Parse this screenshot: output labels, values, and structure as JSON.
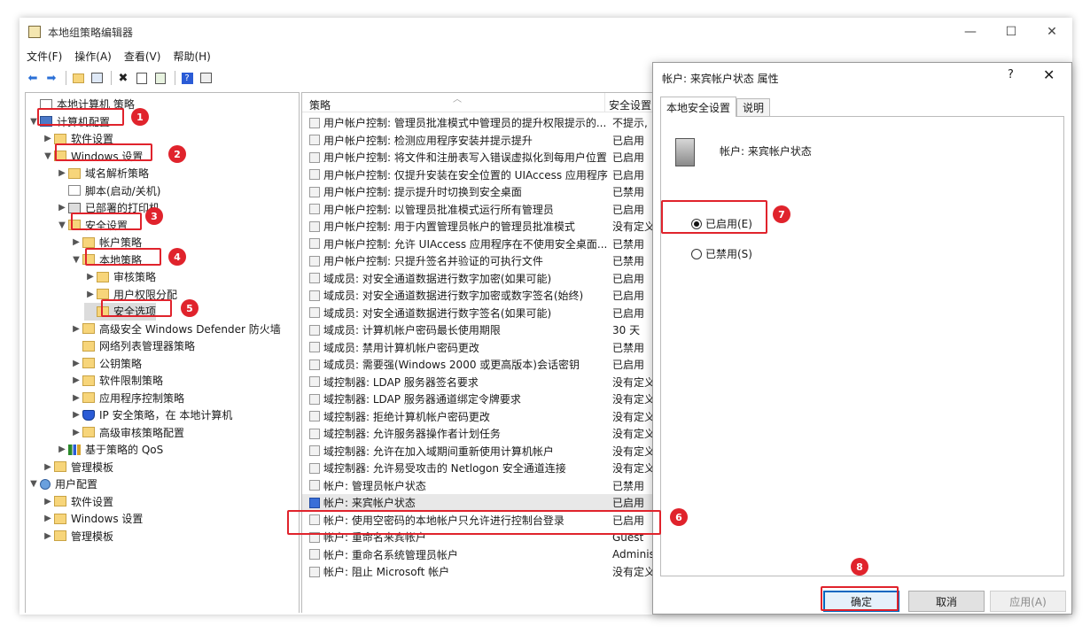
{
  "window": {
    "title": "本地组策略编辑器",
    "controls": [
      "—",
      "☐",
      "✕"
    ]
  },
  "menu": [
    "文件(F)",
    "操作(A)",
    "查看(V)",
    "帮助(H)"
  ],
  "toolbar_icons": [
    "back-arrow-icon",
    "forward-arrow-icon",
    "up-folder-icon",
    "show-tree-icon",
    "delete-icon",
    "properties-icon",
    "export-icon",
    "help-icon",
    "view-icon"
  ],
  "tree": [
    {
      "label": "本地计算机 策略",
      "icon": "policy",
      "depth": 0,
      "arrow": ""
    },
    {
      "label": "计算机配置",
      "icon": "pc",
      "depth": 0,
      "arrow": "▼"
    },
    {
      "label": "软件设置",
      "icon": "folder",
      "depth": 1,
      "arrow": "▶"
    },
    {
      "label": "Windows 设置",
      "icon": "folder",
      "depth": 1,
      "arrow": "▼"
    },
    {
      "label": "域名解析策略",
      "icon": "folder",
      "depth": 2,
      "arrow": "▶"
    },
    {
      "label": "脚本(启动/关机)",
      "icon": "script",
      "depth": 2,
      "arrow": ""
    },
    {
      "label": "已部署的打印机",
      "icon": "printer",
      "depth": 2,
      "arrow": "▶"
    },
    {
      "label": "安全设置",
      "icon": "folder",
      "depth": 2,
      "arrow": "▼"
    },
    {
      "label": "帐户策略",
      "icon": "folder",
      "depth": 3,
      "arrow": "▶"
    },
    {
      "label": "本地策略",
      "icon": "folder",
      "depth": 3,
      "arrow": "▼"
    },
    {
      "label": "审核策略",
      "icon": "folder",
      "depth": 4,
      "arrow": "▶"
    },
    {
      "label": "用户权限分配",
      "icon": "folder",
      "depth": 4,
      "arrow": "▶"
    },
    {
      "label": "安全选项",
      "icon": "folder",
      "depth": 4,
      "arrow": "",
      "selected": true
    },
    {
      "label": "高级安全 Windows Defender 防火墙",
      "icon": "folder",
      "depth": 3,
      "arrow": "▶"
    },
    {
      "label": "网络列表管理器策略",
      "icon": "folder",
      "depth": 3,
      "arrow": ""
    },
    {
      "label": "公钥策略",
      "icon": "folder",
      "depth": 3,
      "arrow": "▶"
    },
    {
      "label": "软件限制策略",
      "icon": "folder",
      "depth": 3,
      "arrow": "▶"
    },
    {
      "label": "应用程序控制策略",
      "icon": "folder",
      "depth": 3,
      "arrow": "▶"
    },
    {
      "label": "IP 安全策略，在 本地计算机",
      "icon": "shield",
      "depth": 3,
      "arrow": "▶"
    },
    {
      "label": "高级审核策略配置",
      "icon": "folder",
      "depth": 3,
      "arrow": "▶"
    },
    {
      "label": "基于策略的 QoS",
      "icon": "qos",
      "depth": 2,
      "arrow": "▶"
    },
    {
      "label": "管理模板",
      "icon": "folder",
      "depth": 1,
      "arrow": "▶"
    },
    {
      "label": "用户配置",
      "icon": "user",
      "depth": 0,
      "arrow": "▼"
    },
    {
      "label": "软件设置",
      "icon": "folder",
      "depth": 1,
      "arrow": "▶"
    },
    {
      "label": "Windows 设置",
      "icon": "folder",
      "depth": 1,
      "arrow": "▶"
    },
    {
      "label": "管理模板",
      "icon": "folder",
      "depth": 1,
      "arrow": "▶"
    }
  ],
  "list": {
    "col_policy": "策略",
    "col_setting": "安全设置",
    "rows": [
      {
        "name": "用户帐户控制: 管理员批准模式中管理员的提升权限提示的...",
        "value": "不提示,"
      },
      {
        "name": "用户帐户控制: 检测应用程序安装并提示提升",
        "value": "已启用"
      },
      {
        "name": "用户帐户控制: 将文件和注册表写入错误虚拟化到每用户位置",
        "value": "已启用"
      },
      {
        "name": "用户帐户控制: 仅提升安装在安全位置的 UIAccess 应用程序",
        "value": "已启用"
      },
      {
        "name": "用户帐户控制: 提示提升时切换到安全桌面",
        "value": "已禁用"
      },
      {
        "name": "用户帐户控制: 以管理员批准模式运行所有管理员",
        "value": "已启用"
      },
      {
        "name": "用户帐户控制: 用于内置管理员帐户的管理员批准模式",
        "value": "没有定义"
      },
      {
        "name": "用户帐户控制: 允许 UIAccess 应用程序在不使用安全桌面...",
        "value": "已禁用"
      },
      {
        "name": "用户帐户控制: 只提升签名并验证的可执行文件",
        "value": "已禁用"
      },
      {
        "name": "域成员: 对安全通道数据进行数字加密(如果可能)",
        "value": "已启用"
      },
      {
        "name": "域成员: 对安全通道数据进行数字加密或数字签名(始终)",
        "value": "已启用"
      },
      {
        "name": "域成员: 对安全通道数据进行数字签名(如果可能)",
        "value": "已启用"
      },
      {
        "name": "域成员: 计算机帐户密码最长使用期限",
        "value": "30 天"
      },
      {
        "name": "域成员: 禁用计算机帐户密码更改",
        "value": "已禁用"
      },
      {
        "name": "域成员: 需要强(Windows 2000 或更高版本)会话密钥",
        "value": "已启用"
      },
      {
        "name": "域控制器: LDAP 服务器签名要求",
        "value": "没有定义"
      },
      {
        "name": "域控制器: LDAP 服务器通道绑定令牌要求",
        "value": "没有定义"
      },
      {
        "name": "域控制器: 拒绝计算机帐户密码更改",
        "value": "没有定义"
      },
      {
        "name": "域控制器: 允许服务器操作者计划任务",
        "value": "没有定义"
      },
      {
        "name": "域控制器:  允许在加入域期间重新使用计算机帐户",
        "value": "没有定义"
      },
      {
        "name": "域控制器:  允许易受攻击的 Netlogon 安全通道连接",
        "value": "没有定义"
      },
      {
        "name": "帐户: 管理员帐户状态",
        "value": "已禁用"
      },
      {
        "name": "帐户: 来宾帐户状态",
        "value": "已启用",
        "selected": true
      },
      {
        "name": "帐户: 使用空密码的本地帐户只允许进行控制台登录",
        "value": "已启用"
      },
      {
        "name": "帐户: 重命名来宾帐户",
        "value": "Guest"
      },
      {
        "name": "帐户: 重命名系统管理员帐户",
        "value": "Administrator"
      },
      {
        "name": "帐户: 阻止 Microsoft 帐户",
        "value": "没有定义"
      }
    ]
  },
  "dialog": {
    "title": "帐户: 来宾帐户状态 属性",
    "help": "?",
    "close": "✕",
    "tabs": [
      "本地安全设置",
      "说明"
    ],
    "policy_title": "帐户: 来宾帐户状态",
    "radio_enabled": "已启用(E)",
    "radio_disabled": "已禁用(S)",
    "enabled_selected": true,
    "ok": "确定",
    "cancel": "取消",
    "apply": "应用(A)"
  },
  "annotations": [
    "1",
    "2",
    "3",
    "4",
    "5",
    "6",
    "7",
    "8"
  ],
  "colors": {
    "annotation": "#e0232c",
    "primary_button_border": "#0067c0"
  }
}
